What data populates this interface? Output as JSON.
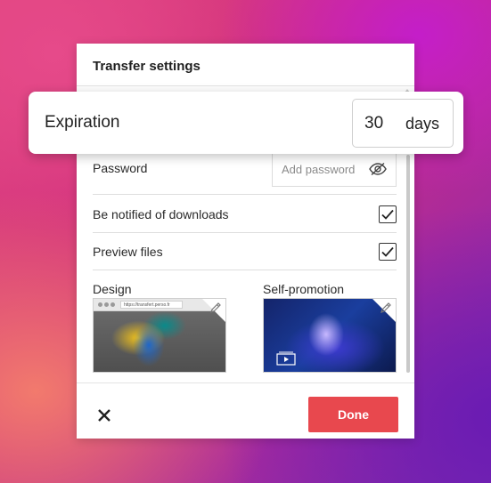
{
  "panel": {
    "title": "Transfer settings"
  },
  "expiration": {
    "label": "Expiration",
    "value": "30",
    "unit": "days"
  },
  "password": {
    "label": "Password",
    "placeholder": "Add password",
    "icon": "eye-icon"
  },
  "options": [
    {
      "label": "Be notified of downloads",
      "checked": true
    },
    {
      "label": "Preview files",
      "checked": true
    }
  ],
  "thumbnails": {
    "design": {
      "label": "Design",
      "url": "https://transfert.perso.fr",
      "icon": "pencil-icon"
    },
    "self_promotion": {
      "label": "Self-promotion",
      "icon": "pencil-icon",
      "overlay_icon": "play-icon"
    }
  },
  "footer": {
    "close_icon": "close-icon",
    "done_label": "Done"
  },
  "colors": {
    "accent": "#e8484e",
    "text": "#222222"
  }
}
